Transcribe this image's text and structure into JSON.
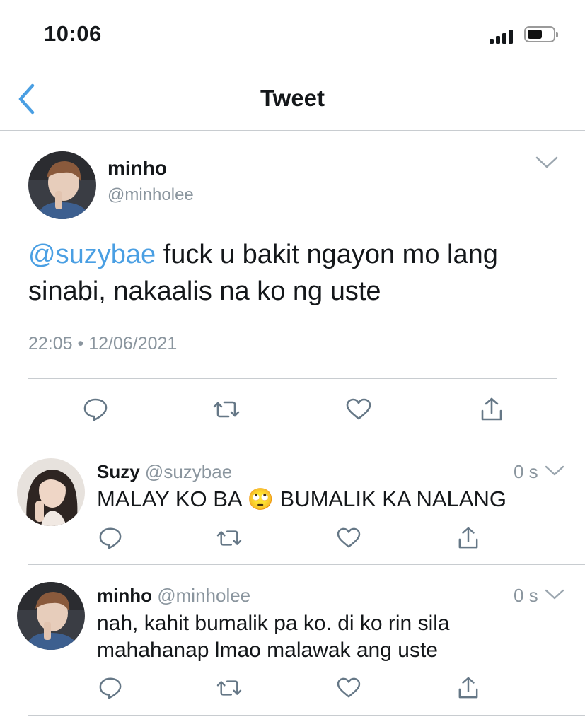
{
  "status_bar": {
    "time": "10:06"
  },
  "header": {
    "title": "Tweet"
  },
  "main_tweet": {
    "display_name": "minho",
    "handle": "@minholee",
    "mention": "@suzybae",
    "text_line1": " fuck u bakit ngayon mo lang",
    "text_line2": "sinabi, nakaalis na ko ng uste",
    "timestamp": "22:05 • 12/06/2021"
  },
  "replies": [
    {
      "display_name": "Suzy",
      "handle": "@suzybae",
      "time": "0 s",
      "text_before": "MALAY KO BA",
      "emoji": "🙄",
      "text_after": "BUMALIK KA NALANG"
    },
    {
      "display_name": "minho",
      "handle": "@minholee",
      "time": "0 s",
      "text_line1": "nah, kahit bumalik pa ko. di ko rin sila",
      "text_line2": "mahahanap lmao malawak ang uste"
    }
  ],
  "colors": {
    "accent": "#4a9fe3",
    "muted": "#8a959e",
    "divider": "#c8ccd0",
    "icon": "#657786"
  }
}
